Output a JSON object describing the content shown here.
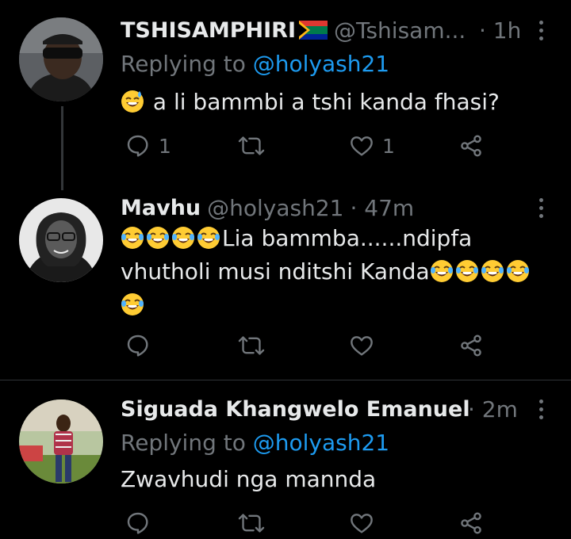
{
  "tweets": [
    {
      "name": "TSHISAMPHIRI",
      "handle": "@Tshisam...",
      "time": "· 1h",
      "reply_label": "Replying to",
      "reply_handle": "@holyash21",
      "text": "a li bammbi a tshi kanda fhasi?",
      "reply_count": "1",
      "like_count": "1"
    },
    {
      "name": "Mavhu",
      "handle": "@holyash21",
      "time": "· 47m",
      "text_line1": "Lia bammba......ndipfa",
      "text_line2": "vhutholi musi nditshi Kanda"
    },
    {
      "name": "Siguada Khangwelo Emanuel",
      "time": "· 2m",
      "reply_label": "Replying to",
      "reply_handle": "@holyash21",
      "text": "Zwavhudi nga mannda"
    }
  ],
  "icons": {
    "reply": "reply-icon",
    "retweet": "retweet-icon",
    "like": "heart-icon",
    "share": "share-icon",
    "more": "more-vertical-icon",
    "emoji": "tears-of-joy-emoji",
    "flag": "south-africa-flag"
  },
  "colors": {
    "background": "#000000",
    "primary_text": "#e7e9ea",
    "secondary_text": "#71767b",
    "mention": "#1d9bf0",
    "divider": "#2f3336"
  }
}
